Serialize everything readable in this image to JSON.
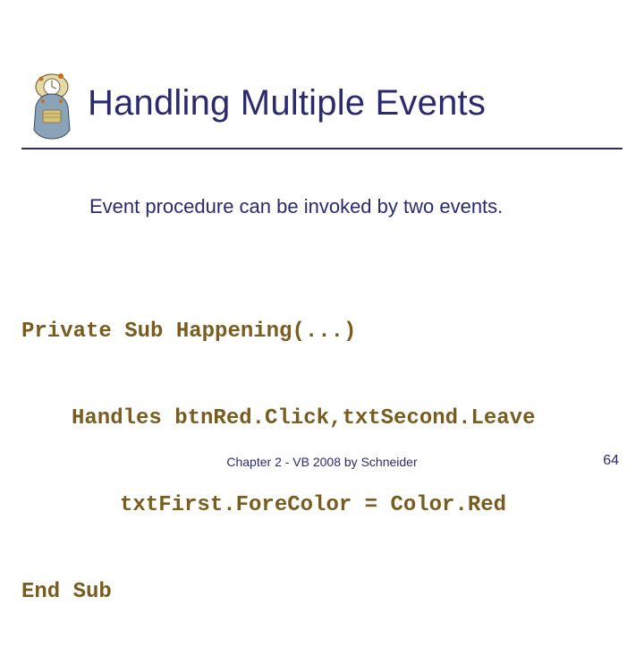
{
  "title": "Handling Multiple Events",
  "subtitle": "Event procedure can be invoked by two events.",
  "code": {
    "line1": "Private Sub Happening(...)",
    "line2": "Handles btnRed.Click,txtSecond.Leave",
    "line3": "txtFirst.ForeColor = Color.Red",
    "line4": "End Sub"
  },
  "footer": {
    "center": "Chapter 2 - VB 2008 by Schneider",
    "page": "64"
  },
  "icons": {
    "logo": "clock-face-logo"
  }
}
